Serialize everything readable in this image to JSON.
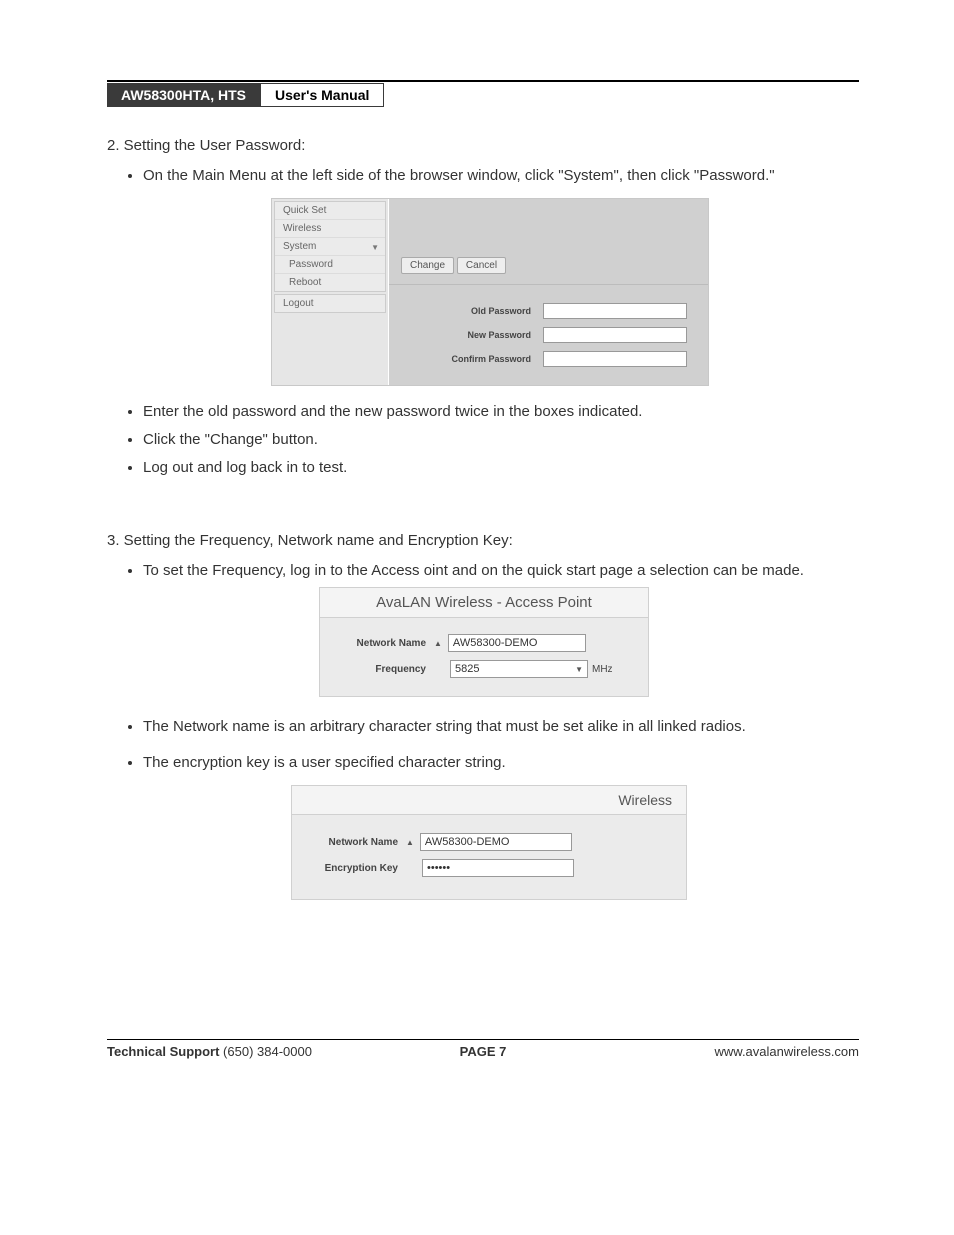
{
  "header": {
    "model": "AW58300HTA, HTS",
    "doc_title": "User's Manual"
  },
  "sections": {
    "s2": {
      "heading": "2. Setting the User Password:",
      "bullets_top": [
        "On the Main Menu at the left side of the browser window, click \"System\", then click \"Password.\""
      ],
      "bullets_bottom": [
        "Enter the old password and the new password twice in the boxes indicated.",
        "Click the \"Change\" button.",
        "Log out and log back in to test."
      ]
    },
    "s3": {
      "heading": "3. Setting the Frequency, Network name and Encryption Key:",
      "bullets_top": [
        "To set the Frequency, log in to the Access oint and on the quick start page a selection can be made."
      ],
      "bullets_mid": [
        "The Network name is an arbitrary character string that must be set alike in all linked radios."
      ],
      "bullets_bottom": [
        "The encryption key is a user specified character string."
      ]
    }
  },
  "ss1": {
    "menu": {
      "top": [
        "Quick Set",
        "Wireless",
        "System"
      ],
      "sub": [
        "Password",
        "Reboot"
      ],
      "logout": "Logout"
    },
    "buttons": {
      "change": "Change",
      "cancel": "Cancel"
    },
    "labels": {
      "old": "Old Password",
      "new": "New Password",
      "confirm": "Confirm Password"
    }
  },
  "ss2": {
    "title": "AvaLAN Wireless - Access Point",
    "network_name_label": "Network Name",
    "network_name_value": "AW58300-DEMO",
    "frequency_label": "Frequency",
    "frequency_value": "5825",
    "frequency_unit": "MHz"
  },
  "ss3": {
    "title": "Wireless",
    "network_name_label": "Network Name",
    "network_name_value": "AW58300-DEMO",
    "encryption_label": "Encryption Key",
    "encryption_value": "••••••"
  },
  "footer": {
    "support_label": "Technical Support",
    "support_phone": " (650) 384-0000",
    "page_label": "PAGE 7",
    "url": "www.avalanwireless.com"
  }
}
